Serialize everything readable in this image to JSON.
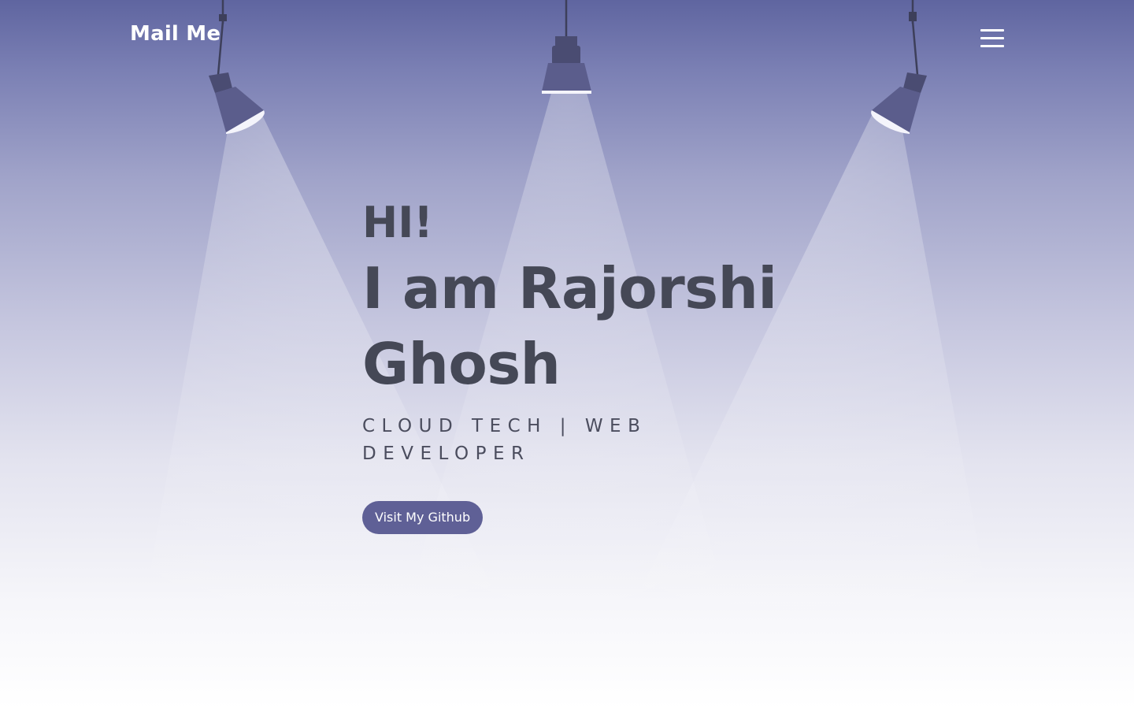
{
  "nav": {
    "logo_text": "Mail Me",
    "menu_icon": "hamburger-menu-icon"
  },
  "hero": {
    "greeting": "HI!",
    "name_line_1": "I am Rajorshi",
    "name_line_2": "Ghosh",
    "tagline_line_1": "CLOUD TECH | WEB",
    "tagline_line_2": "DEVELOPER",
    "button_label": "Visit My Github"
  },
  "decor": {
    "lamps": [
      "spotlight-left-icon",
      "spotlight-center-icon",
      "spotlight-right-icon"
    ]
  },
  "colors": {
    "background_top": "#5f65a0",
    "background_bottom": "#ffffff",
    "heading_text": "#454856",
    "button_bg": "#5f6096",
    "button_text": "#ffffff",
    "nav_text": "#ffffff"
  }
}
